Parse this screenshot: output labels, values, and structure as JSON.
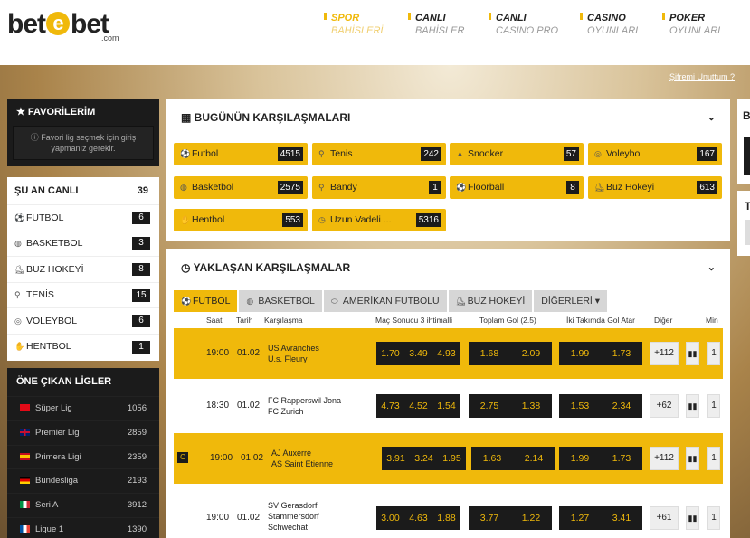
{
  "header": {
    "logo_left": "bet",
    "logo_mid": "e",
    "logo_right": "bet",
    "logo_sub": ".com",
    "nav": [
      {
        "a": "SPOR",
        "b": "BAHİSLERİ"
      },
      {
        "a": "CANLI",
        "b": "BAHİSLER"
      },
      {
        "a": "CANLI",
        "b": "CASINO PRO"
      },
      {
        "a": "CASINO",
        "b": "OYUNLARI"
      },
      {
        "a": "POKER",
        "b": "OYUNLARI"
      }
    ],
    "forgot": "Şifremi Unuttum ?",
    "accent": "#f0b90b"
  },
  "favorites": {
    "title": "FAVORİLERİM",
    "message_1": "Favori lig seçmek için giriş",
    "message_2": "yapmanız gerekir."
  },
  "live": {
    "title": "ŞU AN CANLI",
    "total": "39",
    "items": [
      {
        "label": "FUTBOL",
        "count": "6"
      },
      {
        "label": "BASKETBOL",
        "count": "3"
      },
      {
        "label": "BUZ HOKEYİ",
        "count": "8"
      },
      {
        "label": "TENİS",
        "count": "15"
      },
      {
        "label": "VOLEYBOL",
        "count": "6"
      },
      {
        "label": "HENTBOL",
        "count": "1"
      }
    ]
  },
  "leagues": {
    "title": "ÖNE ÇIKAN LİGLER",
    "items": [
      {
        "label": "Süper Lig",
        "count": "1056"
      },
      {
        "label": "Premier Lig",
        "count": "2859"
      },
      {
        "label": "Primera Ligi",
        "count": "2359"
      },
      {
        "label": "Bundesliga",
        "count": "2193"
      },
      {
        "label": "Seri A",
        "count": "3912"
      },
      {
        "label": "Ligue 1",
        "count": "1390"
      }
    ]
  },
  "today": {
    "title": "BUGÜNÜN KARŞILAŞMALARI",
    "tiles": [
      {
        "label": "Futbol",
        "count": "4515"
      },
      {
        "label": "Tenis",
        "count": "242"
      },
      {
        "label": "Snooker",
        "count": "57"
      },
      {
        "label": "Voleybol",
        "count": "167"
      },
      {
        "label": "Basketbol",
        "count": "2575"
      },
      {
        "label": "Bandy",
        "count": "1"
      },
      {
        "label": "Floorball",
        "count": "8"
      },
      {
        "label": "Buz Hokeyi",
        "count": "613"
      },
      {
        "label": "Hentbol",
        "count": "553"
      },
      {
        "label": "Uzun Vadeli ...",
        "count": "5316"
      }
    ]
  },
  "upcoming": {
    "title": "YAKLAŞAN KARŞILAŞMALAR",
    "tabs": [
      "FUTBOL",
      "BASKETBOL",
      "AMERİKAN FUTBOLU",
      "BUZ HOKEYİ",
      "DİĞERLERİ"
    ],
    "cols": {
      "saat": "Saat",
      "tarih": "Tarih",
      "match": "Karşılaşma",
      "ms": "Maç Sonucu 3 ihtimalli",
      "tg": "Toplam Gol (2.5)",
      "kg": "İki Takımda Gol Atar",
      "other": "Diğer",
      "min": "Min"
    },
    "matches": [
      {
        "time": "19:00",
        "date": "01.02",
        "home": "US Avranches",
        "away": "U.s. Fleury",
        "ms": [
          "1.70",
          "3.49",
          "4.93"
        ],
        "tg": [
          "1.68",
          "2.09"
        ],
        "kg": [
          "1.99",
          "1.73"
        ],
        "more": "+112",
        "min": "1"
      },
      {
        "time": "18:30",
        "date": "01.02",
        "home": "FC Rapperswil Jona",
        "away": "FC Zurich",
        "ms": [
          "4.73",
          "4.52",
          "1.54"
        ],
        "tg": [
          "2.75",
          "1.38"
        ],
        "kg": [
          "1.53",
          "2.34"
        ],
        "more": "+62",
        "min": "1"
      },
      {
        "time": "19:00",
        "date": "01.02",
        "home": "AJ Auxerre",
        "away": "AS Saint Etienne",
        "ms": [
          "3.91",
          "3.24",
          "1.95"
        ],
        "tg": [
          "1.63",
          "2.14"
        ],
        "kg": [
          "1.99",
          "1.73"
        ],
        "more": "+112",
        "min": "1",
        "badge": "C"
      },
      {
        "time": "19:00",
        "date": "01.02",
        "home": "SV Gerasdorf",
        "away": "Stammersdorf",
        "away2": "Schwechat",
        "ms": [
          "3.00",
          "4.63",
          "1.88"
        ],
        "tg": [
          "3.77",
          "1.22"
        ],
        "kg": [
          "1.27",
          "3.41"
        ],
        "more": "+61",
        "min": "1"
      }
    ]
  },
  "right_panel": {
    "letter_1": "B",
    "letter_2": "T"
  }
}
